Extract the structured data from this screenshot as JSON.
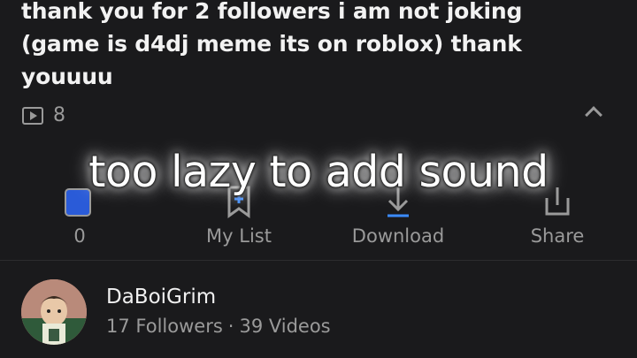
{
  "post": {
    "description": "thank you for 2 followers i am not joking (game is d4dj meme its on roblox) thank youuuu",
    "play_count": "8"
  },
  "overlay": {
    "caption": "too lazy to add sound"
  },
  "actions": {
    "like_count": "0",
    "mylist_label": "My List",
    "download_label": "Download",
    "share_label": "Share"
  },
  "channel": {
    "name": "DaBoiGrim",
    "followers": "17 Followers",
    "separator": "·",
    "videos": "39 Videos"
  },
  "colors": {
    "background": "#1a1a1c",
    "text_primary": "#f2f2f2",
    "text_secondary": "#9a9a9a",
    "accent": "#3b8bff"
  },
  "icons": {
    "plays": "play-box-icon",
    "collapse": "chevron-up-icon",
    "like": "like-icon",
    "mylist": "bookmark-add-icon",
    "download": "download-icon",
    "share": "share-icon"
  }
}
